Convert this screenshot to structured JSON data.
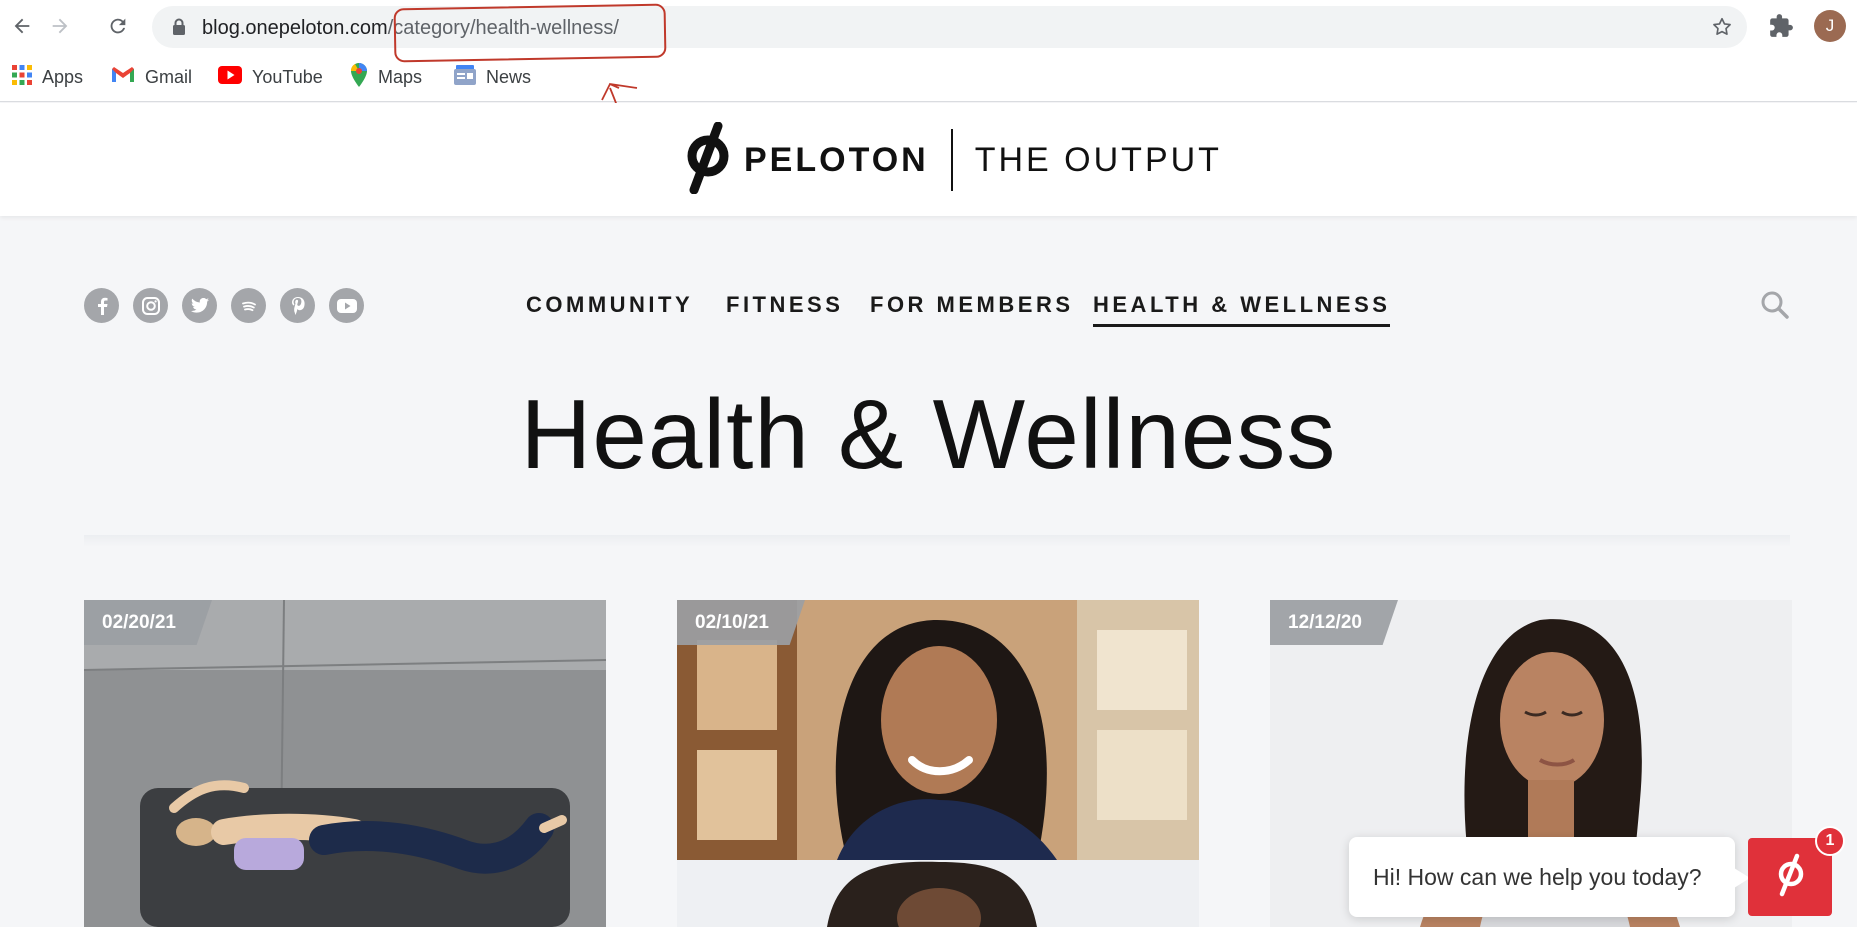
{
  "browser": {
    "url_host": "blog.onepeloton.com",
    "url_path": "/category/health-wellness/",
    "avatar_initial": "J",
    "bookmarks": [
      {
        "label": "Apps",
        "icon": "apps-grid-icon"
      },
      {
        "label": "Gmail",
        "icon": "gmail-icon"
      },
      {
        "label": "YouTube",
        "icon": "youtube-icon"
      },
      {
        "label": "Maps",
        "icon": "maps-icon"
      },
      {
        "label": "News",
        "icon": "news-icon"
      }
    ]
  },
  "site": {
    "brand": "PELOTON",
    "section": "THE OUTPUT",
    "social_icons": [
      "facebook-icon",
      "instagram-icon",
      "twitter-icon",
      "spotify-icon",
      "pinterest-icon",
      "youtube-icon"
    ],
    "nav": [
      {
        "label": "COMMUNITY",
        "active": false
      },
      {
        "label": "FITNESS",
        "active": false
      },
      {
        "label": "FOR MEMBERS",
        "active": false
      },
      {
        "label": "HEALTH & WELLNESS",
        "active": true
      }
    ],
    "page_title": "Health & Wellness"
  },
  "cards": [
    {
      "date": "02/20/21"
    },
    {
      "date": "02/10/21"
    },
    {
      "date": "12/12/20"
    }
  ],
  "chat": {
    "message": "Hi! How can we help you today?",
    "badge_count": "1"
  },
  "colors": {
    "accent_red": "#e0313a",
    "annotation_red": "#c0392b",
    "page_bg": "#f5f6f8"
  }
}
